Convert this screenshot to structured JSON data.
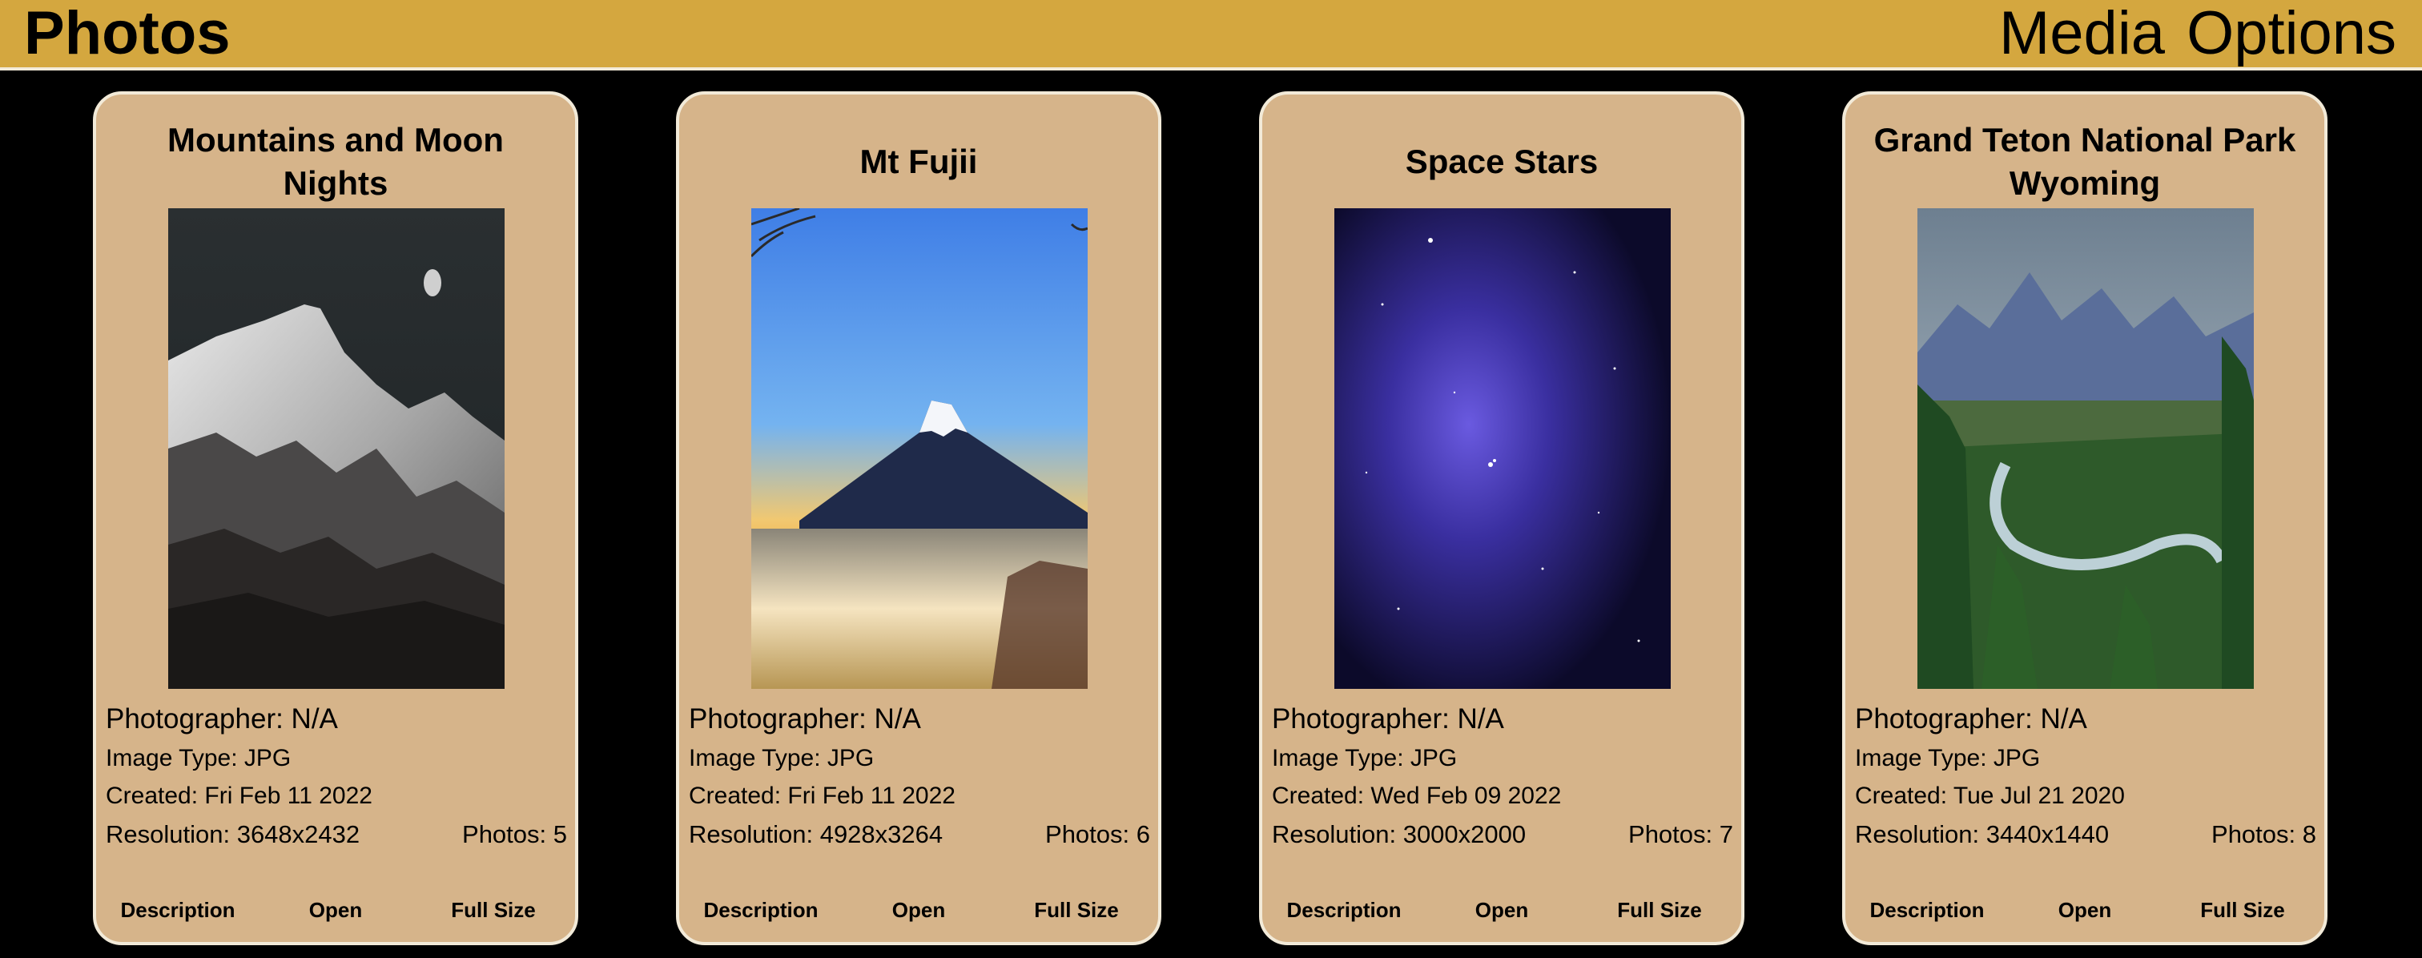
{
  "header": {
    "title": "Photos",
    "menu_label": "Media Options",
    "color": "#d4a73f"
  },
  "cards": [
    {
      "title": "Mountains and Moon Nights",
      "photographer": "Photographer: N/A",
      "image_type": "Image Type: JPG",
      "created": "Created: Fri Feb 11 2022",
      "resolution": "Resolution: 3648x2432",
      "photos": "Photos: 5",
      "buttons": {
        "description": "Description",
        "open": "Open",
        "full_size": "Full Size"
      }
    },
    {
      "title": "Mt Fujii",
      "photographer": "Photographer: N/A",
      "image_type": "Image Type: JPG",
      "created": "Created: Fri Feb 11 2022",
      "resolution": "Resolution: 4928x3264",
      "photos": "Photos: 6",
      "buttons": {
        "description": "Description",
        "open": "Open",
        "full_size": "Full Size"
      }
    },
    {
      "title": "Space Stars",
      "photographer": "Photographer: N/A",
      "image_type": "Image Type: JPG",
      "created": "Created: Wed Feb 09 2022",
      "resolution": "Resolution: 3000x2000",
      "photos": "Photos: 7",
      "buttons": {
        "description": "Description",
        "open": "Open",
        "full_size": "Full Size"
      }
    },
    {
      "title": "Grand Teton National Park Wyoming",
      "photographer": "Photographer: N/A",
      "image_type": "Image Type: JPG",
      "created": "Created: Tue Jul 21 2020",
      "resolution": "Resolution: 3440x1440",
      "photos": "Photos: 8",
      "buttons": {
        "description": "Description",
        "open": "Open",
        "full_size": "Full Size"
      }
    }
  ],
  "colors": {
    "card_background": "#d6b48a",
    "card_border": "#f2ead8",
    "page_background": "#000000"
  }
}
